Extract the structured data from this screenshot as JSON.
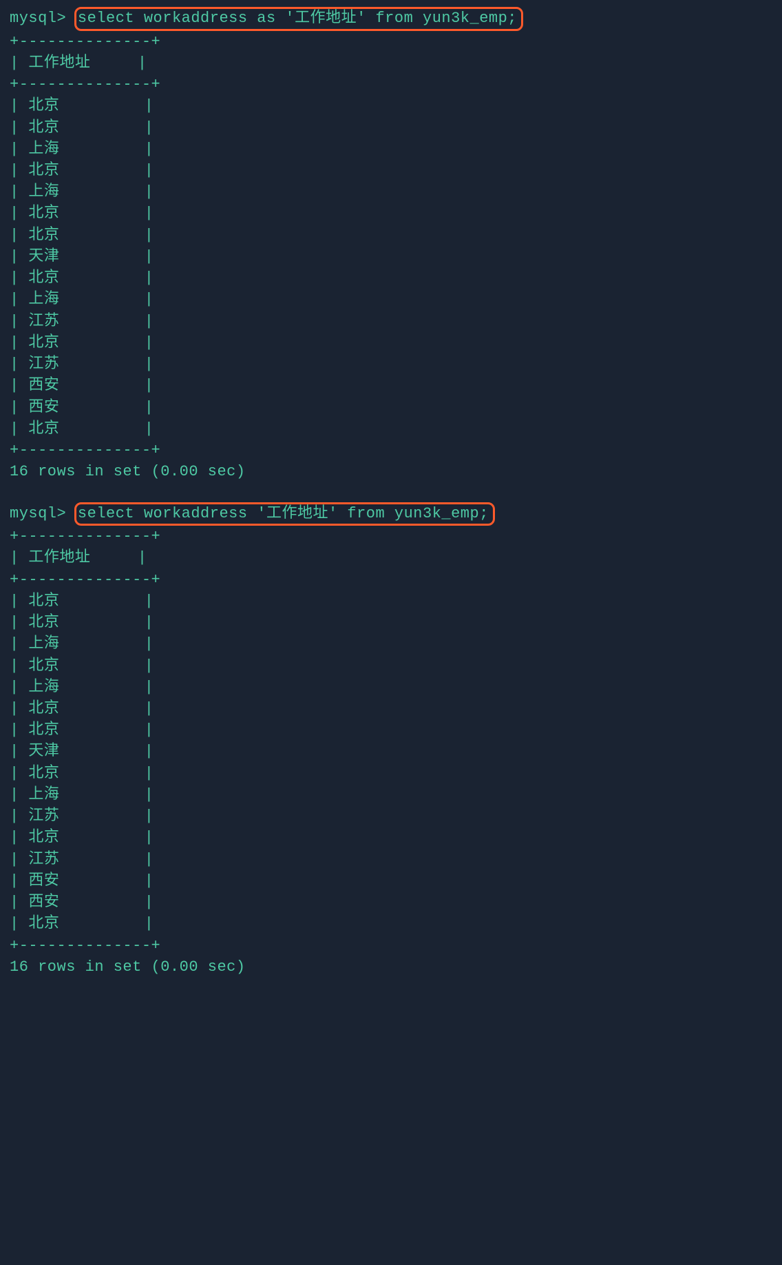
{
  "prompt": "mysql>",
  "queries": {
    "q1": "select workaddress as '工作地址' from yun3k_emp;",
    "q2": "select workaddress '工作地址' from yun3k_emp;"
  },
  "table": {
    "border_top": "+--------------+",
    "header_label": "工作地址",
    "rows": [
      "北京",
      "北京",
      "上海",
      "北京",
      "上海",
      "北京",
      "北京",
      "天津",
      "北京",
      "上海",
      "江苏",
      "北京",
      "江苏",
      "西安",
      "西安",
      "北京"
    ]
  },
  "footer": "16 rows in set (0.00 sec)"
}
